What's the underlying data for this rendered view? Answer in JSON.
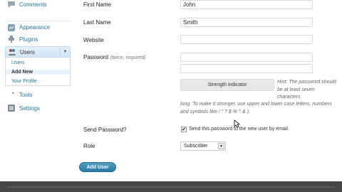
{
  "sidebar": {
    "items": [
      {
        "label": "Comments"
      },
      {
        "label": "Appearance"
      },
      {
        "label": "Plugins"
      },
      {
        "label": "Users"
      },
      {
        "label": "Tools"
      },
      {
        "label": "Settings"
      }
    ],
    "users_submenu": [
      "Users",
      "Add New",
      "Your Profile"
    ]
  },
  "form": {
    "first_name": {
      "label": "First Name",
      "value": "John"
    },
    "last_name": {
      "label": "Last Name",
      "value": "Smith"
    },
    "website": {
      "label": "Website",
      "value": ""
    },
    "password": {
      "label": "Password",
      "hint": "(twice, required)"
    },
    "strength_label": "Strength indicator",
    "hint_part1": "Hint: The password should be at least seven characters",
    "hint_part2": "long. To make it stronger, use upper and lower case letters, numbers and symbols like ! \" ? $ % ^ & ).",
    "send_password": {
      "label": "Send Password?",
      "text": "Send this password to the new user by email.",
      "checked": true,
      "check_mark": "✔"
    },
    "role": {
      "label": "Role",
      "value": "Subscriber"
    },
    "submit_label": "Add User"
  },
  "colors": {
    "link": "#21759b",
    "button": "#2a7aa3",
    "footer": "#464646"
  }
}
